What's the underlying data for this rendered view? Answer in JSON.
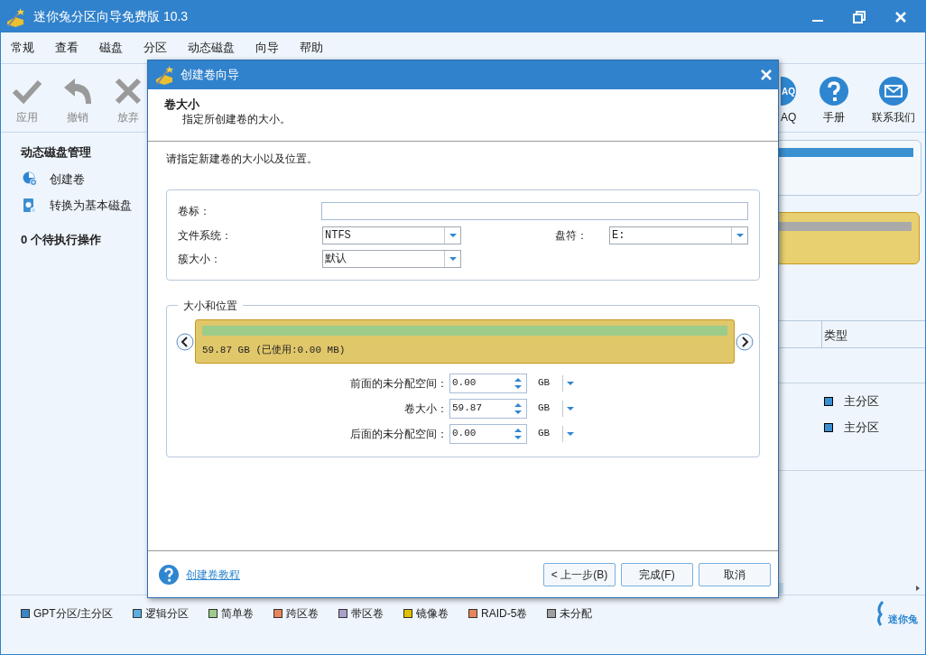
{
  "window": {
    "title": "迷你兔分区向导免费版 10.3"
  },
  "menu": [
    "常规",
    "查看",
    "磁盘",
    "分区",
    "动态磁盘",
    "向导",
    "帮助"
  ],
  "toolbar_left": [
    {
      "label": "应用",
      "disabled": true
    },
    {
      "label": "撤销",
      "disabled": true
    },
    {
      "label": "放弃",
      "disabled": true
    }
  ],
  "toolbar_right": [
    {
      "label": "AQ",
      "icon_text": "AQ",
      "disabled": false
    },
    {
      "label": "手册",
      "disabled": false
    },
    {
      "label": "联系我们",
      "disabled": false
    }
  ],
  "sidebar": {
    "title": "动态磁盘管理",
    "items": [
      {
        "label": "创建卷"
      },
      {
        "label": "转换为基本磁盘"
      }
    ],
    "pending": "0 个待执行操作"
  },
  "partition_table": {
    "column": "类型",
    "rows": [
      {
        "type": "主分区",
        "color": "#3a8fd0"
      },
      {
        "type": "主分区",
        "color": "#3a8fd0"
      }
    ]
  },
  "legend": [
    {
      "label": "GPT分区/主分区",
      "color": "#3a86c8"
    },
    {
      "label": "逻辑分区",
      "color": "#5aaee0"
    },
    {
      "label": "简单卷",
      "color": "#9ccc8a"
    },
    {
      "label": "跨区卷",
      "color": "#e8845a"
    },
    {
      "label": "带区卷",
      "color": "#a9a0cc"
    },
    {
      "label": "镜像卷",
      "color": "#e0c000"
    },
    {
      "label": "RAID-5卷",
      "color": "#e8845a"
    },
    {
      "label": "未分配",
      "color": "#a0a0a0"
    }
  ],
  "dialog": {
    "title": "创建卷向导",
    "header_title": "卷大小",
    "header_subtitle": "指定所创建卷的大小。",
    "instruction": "请指定新建卷的大小以及位置。",
    "fields": {
      "label": {
        "label": "卷标："
      },
      "file_system": {
        "label": "文件系统：",
        "value": "NTFS"
      },
      "drive_letter": {
        "label": "盘符：",
        "value": "E:"
      },
      "cluster_size": {
        "label": "簇大小：",
        "value": "默认"
      }
    },
    "size_group": {
      "title": "大小和位置",
      "bar_text": "59.87 GB (已使用:0.00 MB)",
      "rows": [
        {
          "label": "前面的未分配空间：",
          "value": "0.00",
          "unit": "GB"
        },
        {
          "label": "卷大小：",
          "value": "59.87",
          "unit": "GB"
        },
        {
          "label": "后面的未分配空间：",
          "value": "0.00",
          "unit": "GB"
        }
      ]
    },
    "help_link": "创建卷教程",
    "buttons": [
      "< 上一步(B)",
      "完成(F)",
      "取消"
    ]
  },
  "logo_text": "迷你兔"
}
